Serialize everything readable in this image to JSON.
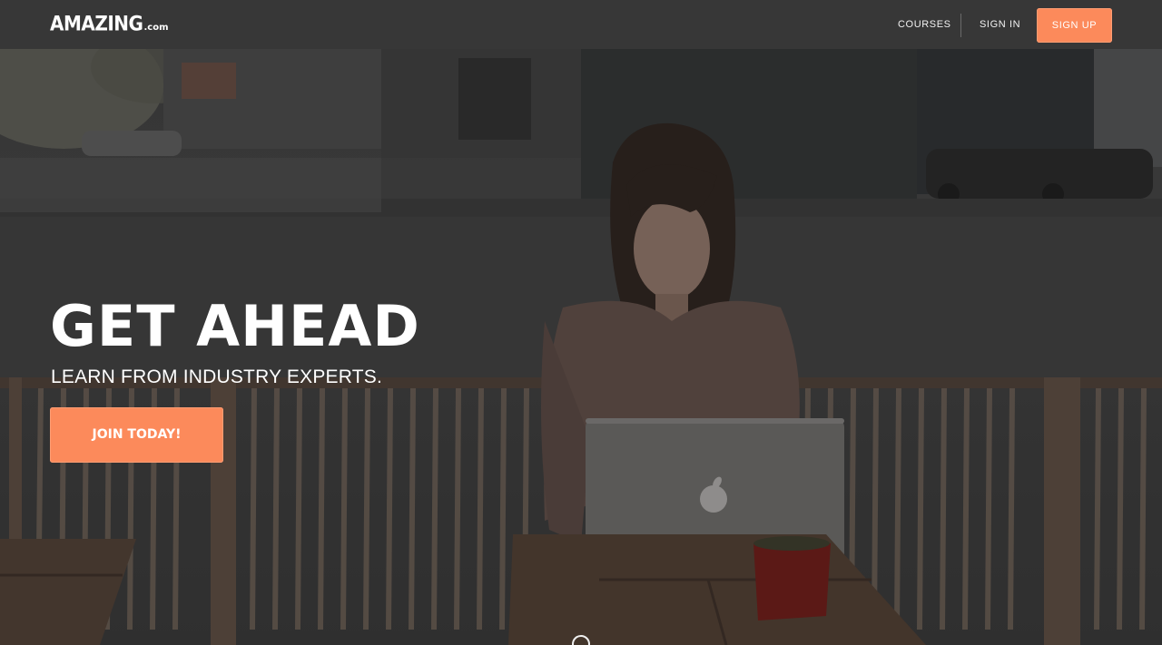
{
  "nav": {
    "logo_main": "AMAZING",
    "logo_suffix": ".com",
    "courses_label": "COURSES",
    "signin_label": "SIGN IN",
    "signup_label": "SIGN UP"
  },
  "hero": {
    "title": "GET AHEAD",
    "subtitle": "LEARN FROM INDUSTRY EXPERTS.",
    "cta_label": "JOIN TODAY!"
  },
  "colors": {
    "accent": "#fc8a5b",
    "navbar": "#373737",
    "text": "#ffffff"
  },
  "icons": {
    "scroll": "scroll-down-circle-icon"
  }
}
